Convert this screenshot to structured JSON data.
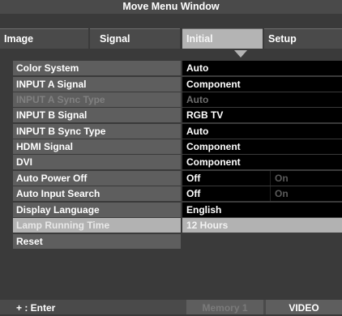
{
  "window": {
    "title": "Move Menu Window"
  },
  "tabs": [
    {
      "label": "Image"
    },
    {
      "label": "Signal"
    },
    {
      "label": "Initial"
    },
    {
      "label": "Setup"
    }
  ],
  "rows": [
    {
      "label": "Color System",
      "value": "Auto"
    },
    {
      "label": "INPUT A Signal",
      "value": "Component"
    },
    {
      "label": "INPUT A Sync Type",
      "value": "Auto"
    },
    {
      "label": "INPUT B Signal",
      "value": "RGB TV"
    },
    {
      "label": "INPUT B Sync Type",
      "value": "Auto"
    },
    {
      "label": "HDMI Signal",
      "value": "Component"
    },
    {
      "label": "DVI",
      "value": "Component"
    },
    {
      "label": "Auto Power Off",
      "value": "Off",
      "alt": "On"
    },
    {
      "label": "Auto Input Search",
      "value": "Off",
      "alt": "On"
    },
    {
      "label": "Display Language",
      "value": "English"
    },
    {
      "label": "Lamp Running Time",
      "value": "12 Hours"
    },
    {
      "label": "Reset",
      "value": ""
    }
  ],
  "footer": {
    "enter": "+ : Enter",
    "memory": "Memory 1",
    "source": "VIDEO"
  },
  "colors": {
    "selected": "#b4b4b4",
    "label_bg": "#5e5e5e",
    "value_bg": "#000000",
    "background": "#3a3a3a"
  }
}
